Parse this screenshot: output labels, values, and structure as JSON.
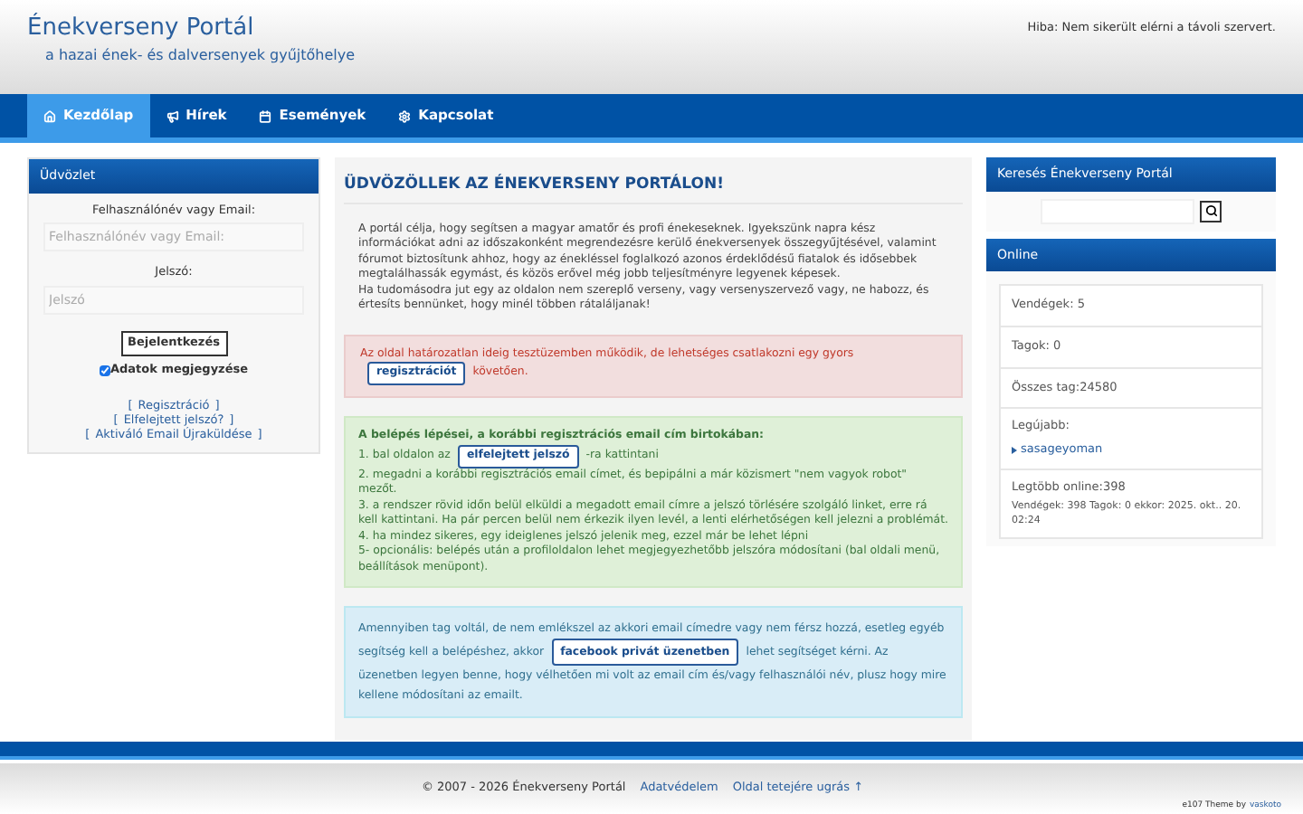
{
  "header": {
    "title": "Énekverseny Portál",
    "subtitle": "a hazai ének- és dalversenyek gyűjtőhelye",
    "error": "Hiba: Nem sikerült elérni a távoli szervert."
  },
  "nav": [
    {
      "label": "Kezdőlap",
      "selected": true
    },
    {
      "label": "Hírek",
      "selected": false
    },
    {
      "label": "Események",
      "selected": false
    },
    {
      "label": "Kapcsolat",
      "selected": false
    }
  ],
  "login": {
    "title": "Üdvözlet",
    "user_label": "Felhasználónév vagy Email:",
    "user_placeholder": "Felhasználónév vagy Email:",
    "pass_label": "Jelszó:",
    "pass_placeholder": "Jelszó",
    "button": "Bejelentkezés",
    "remember": {
      "label": "Adatok megjegyzése",
      "checked": true
    },
    "links": [
      {
        "open": "[",
        "label": "Regisztráció",
        "close": "]"
      },
      {
        "open": "[",
        "label": "Elfelejtett jelszó?",
        "close": "]"
      },
      {
        "open": "[",
        "label": "Aktiváló Email Újraküldése",
        "close": "]"
      }
    ]
  },
  "main": {
    "heading": "ÜDVÖZÖLLEK AZ ÉNEKVERSENY PORTÁLON!",
    "intro": [
      "A portál célja, hogy segítsen a magyar amatőr és profi énekeseknek. Igyekszünk napra kész információkat adni az időszakonként megrendezésre kerülő énekversenyek összegyűjtésével, valamint fórumot biztosítunk ahhoz, hogy az énekléssel foglalkozó azonos érdeklődésű fiatalok és idősebbek megtalálhassák egymást, és közös erővel még jobb teljesítményre legyenek képesek.",
      "Ha tudomásodra jut egy az oldalon nem szereplő verseny, vagy versenyszervező vagy, ne habozz, és értesíts bennünket, hogy minél többen rátaláljanak!"
    ],
    "notice": {
      "before": "Az oldal határozatlan ideig tesztüzemben működik, de lehetséges csatlakozni egy gyors",
      "link": "regisztrációt",
      "after": "követően."
    },
    "steps": {
      "title": "A belépés lépései, a korábbi regisztrációs email cím birtokában:",
      "first": {
        "before": "1. bal oldalon az",
        "link": "elfelejtett jelszó",
        "after": "-ra kattintani"
      },
      "items": [
        "2. megadni a korábbi regisztrációs email címet, és bepipálni a már közismert \"nem vagyok robot\" mezőt.",
        "3. a rendszer rövid időn belül elküldi a megadott email címre a jelszó törlésére szolgáló linket, erre rá kell kattintani. Ha pár percen belül nem érkezik ilyen levél, a lenti elérhetőségen kell jelezni a problémát.",
        "4. ha mindez sikeres, egy ideiglenes jelszó jelenik meg, ezzel már be lehet lépni",
        "5- opcionális: belépés után a profiloldalon lehet megjegyezhetőbb jelszóra módosítani (bal oldali menü, beállítások menüpont)."
      ]
    },
    "help": {
      "before": "Amennyiben tag voltál, de nem emlékszel az akkori email címedre vagy nem férsz hozzá, esetleg egyéb segítség kell a belépéshez, akkor",
      "link": "facebook privát üzenetben",
      "after": "lehet segítséget kérni. Az üzenetben legyen benne, hogy vélhetően mi volt az email cím és/vagy felhasználói név, plusz hogy mire kellene módosítani az emailt."
    }
  },
  "search": {
    "title": "Keresés Énekverseny Portál"
  },
  "online": {
    "title": "Online",
    "guests": "Vendégek: 5",
    "members": "Tagok: 0",
    "total": "Összes tag:24580",
    "newest_label": "Legújabb:",
    "newest": "sasageyoman",
    "most": "Legtöbb online:398",
    "most_detail": "Vendégek: 398 Tagok: 0 ekkor: 2025. okt.. 20. 02:24"
  },
  "footer": {
    "copyright": "© 2007 - 2026 Énekverseny Portál",
    "links": [
      "Adatvédelem",
      "Oldal tetejére ugrás ↑"
    ],
    "theme": "e107 Theme by",
    "theme_author": "vaskoto"
  }
}
